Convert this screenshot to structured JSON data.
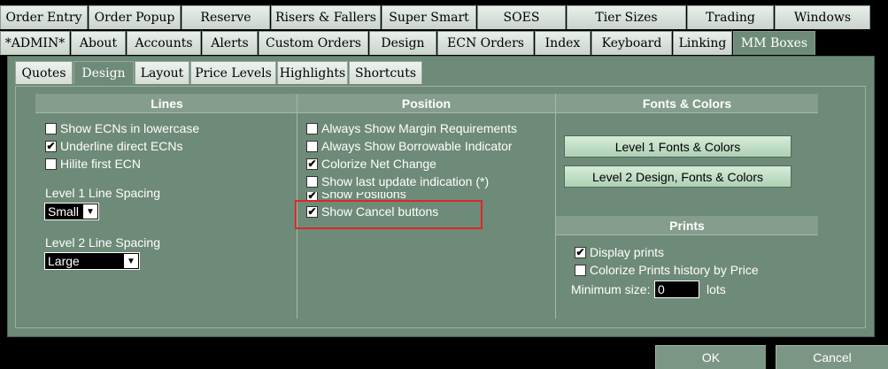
{
  "tabs_row1": [
    "Order Entry",
    "Order Popup",
    "Reserve",
    "Risers & Fallers",
    "Super Smart",
    "SOES",
    "Tier Sizes",
    "Trading",
    "Windows"
  ],
  "tabs_row2": [
    "*ADMIN*",
    "About",
    "Accounts",
    "Alerts",
    "Custom Orders",
    "Design",
    "ECN Orders",
    "Index",
    "Keyboard",
    "Linking",
    "MM Boxes"
  ],
  "active_tab": "MM Boxes",
  "subtabs": [
    "Quotes",
    "Design",
    "Layout",
    "Price Levels",
    "Highlights",
    "Shortcuts"
  ],
  "active_subtab": "Design",
  "lines": {
    "header": "Lines",
    "options": [
      {
        "label": "Show ECNs in lowercase",
        "checked": false
      },
      {
        "label": "Underline direct ECNs",
        "checked": true
      },
      {
        "label": "Hilite first ECN",
        "checked": false
      }
    ],
    "level1_label": "Level 1 Line Spacing",
    "level1_value": "Small",
    "level2_label": "Level 2 Line Spacing",
    "level2_value": "Large"
  },
  "position": {
    "header": "Position",
    "options": [
      {
        "label": "Always Show Margin Requirements",
        "checked": false
      },
      {
        "label": "Always Show Borrowable Indicator",
        "checked": false
      },
      {
        "label": "Colorize Net Change",
        "checked": true
      },
      {
        "label": "Show last update indication (*)",
        "checked": false
      },
      {
        "label": "Show Positions",
        "checked": true
      },
      {
        "label": "Show Cancel buttons",
        "checked": true
      }
    ]
  },
  "fonts_colors": {
    "header": "Fonts & Colors",
    "btn1": "Level 1 Fonts & Colors",
    "btn2": "Level 2 Design, Fonts & Colors"
  },
  "prints": {
    "header": "Prints",
    "display_prints": {
      "label": "Display prints",
      "checked": true
    },
    "colorize_prints": {
      "label": "Colorize Prints history by Price",
      "checked": false
    },
    "min_size_label": "Minimum size:",
    "min_size_value": "0",
    "min_size_unit": "lots"
  },
  "footer": {
    "ok": "OK",
    "cancel": "Cancel"
  },
  "colors": {
    "panel": "#6e8a78",
    "highlight": "#e0262b"
  }
}
